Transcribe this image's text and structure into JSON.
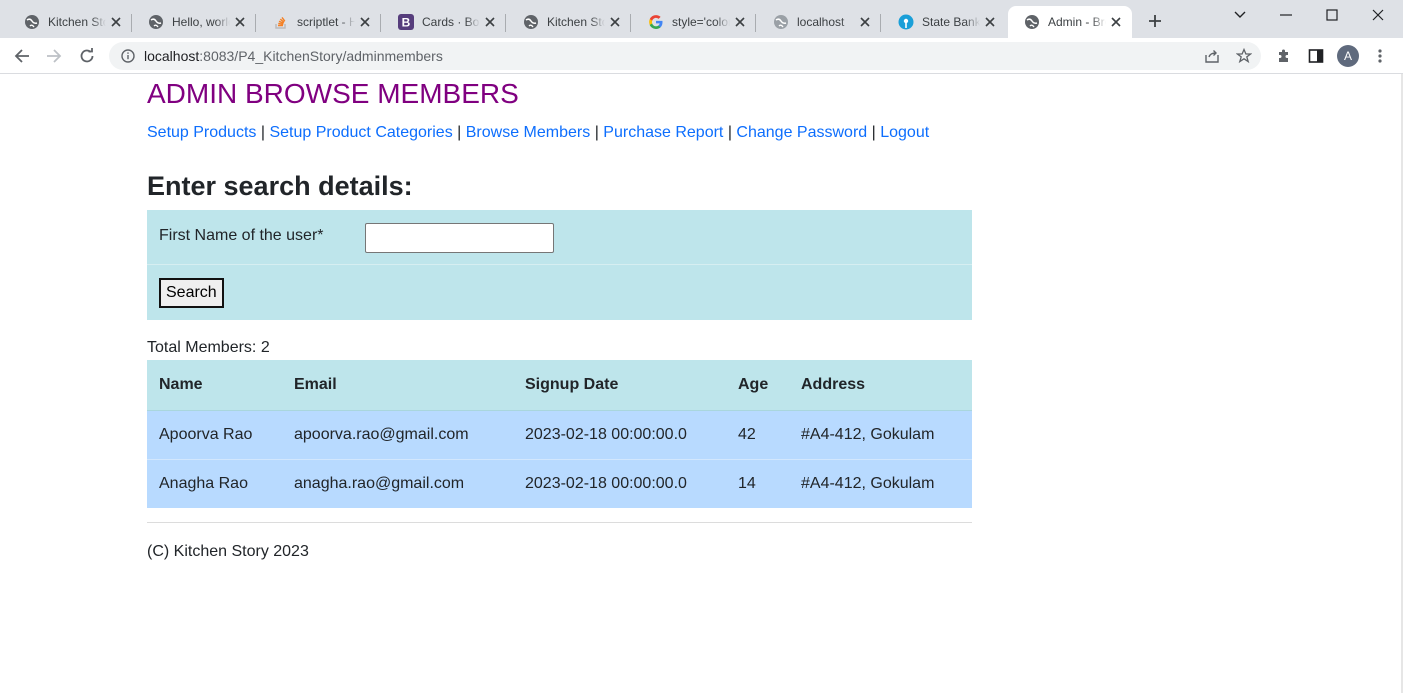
{
  "browser": {
    "tabs": [
      {
        "title": "Kitchen Story",
        "icon": "globe-icon",
        "active": false
      },
      {
        "title": "Hello, world",
        "icon": "globe-icon",
        "active": false
      },
      {
        "title": "scriptlet - H",
        "icon": "stack-overflow-icon",
        "active": false
      },
      {
        "title": "Cards · Boot",
        "icon": "bootstrap-icon",
        "active": false
      },
      {
        "title": "Kitchen Story",
        "icon": "globe-icon",
        "active": false
      },
      {
        "title": "style='color",
        "icon": "google-icon",
        "active": false
      },
      {
        "title": "localhost",
        "icon": "globe-icon",
        "active": false
      },
      {
        "title": "State Bank",
        "icon": "sbi-icon",
        "active": false
      },
      {
        "title": "Admin - Bro",
        "icon": "globe-icon",
        "active": true
      }
    ],
    "url_host": "localhost",
    "url_path": ":8083/P4_KitchenStory/adminmembers",
    "profile_initial": "A"
  },
  "page": {
    "title": "ADMIN BROWSE MEMBERS",
    "nav": {
      "setup_products": "Setup Products",
      "setup_categories": "Setup Product Categories",
      "browse_members": "Browse Members",
      "purchase_report": "Purchase Report",
      "change_password": "Change Password",
      "logout": "Logout",
      "separator": "|"
    },
    "search": {
      "heading": "Enter search details:",
      "first_name_label": "First Name of the user*",
      "first_name_value": "",
      "button_label": "Search"
    },
    "total_members": "Total Members: 2",
    "table": {
      "headers": {
        "name": "Name",
        "email": "Email",
        "signup": "Signup Date",
        "age": "Age",
        "address": "Address"
      },
      "rows": [
        {
          "name": "Apoorva Rao",
          "email": "apoorva.rao@gmail.com",
          "signup": "2023-02-18 00:00:00.0",
          "age": "42",
          "address": "#A4-412, Gokulam"
        },
        {
          "name": "Anagha Rao",
          "email": "anagha.rao@gmail.com",
          "signup": "2023-02-18 00:00:00.0",
          "age": "14",
          "address": "#A4-412, Gokulam"
        }
      ]
    },
    "footer": "(C) Kitchen Story 2023"
  },
  "colors": {
    "title": "#800080",
    "link": "#0d6efd",
    "search_box_bg": "#bee5eb",
    "table_header_bg": "#bee5eb",
    "table_row_bg": "#b8daff"
  }
}
